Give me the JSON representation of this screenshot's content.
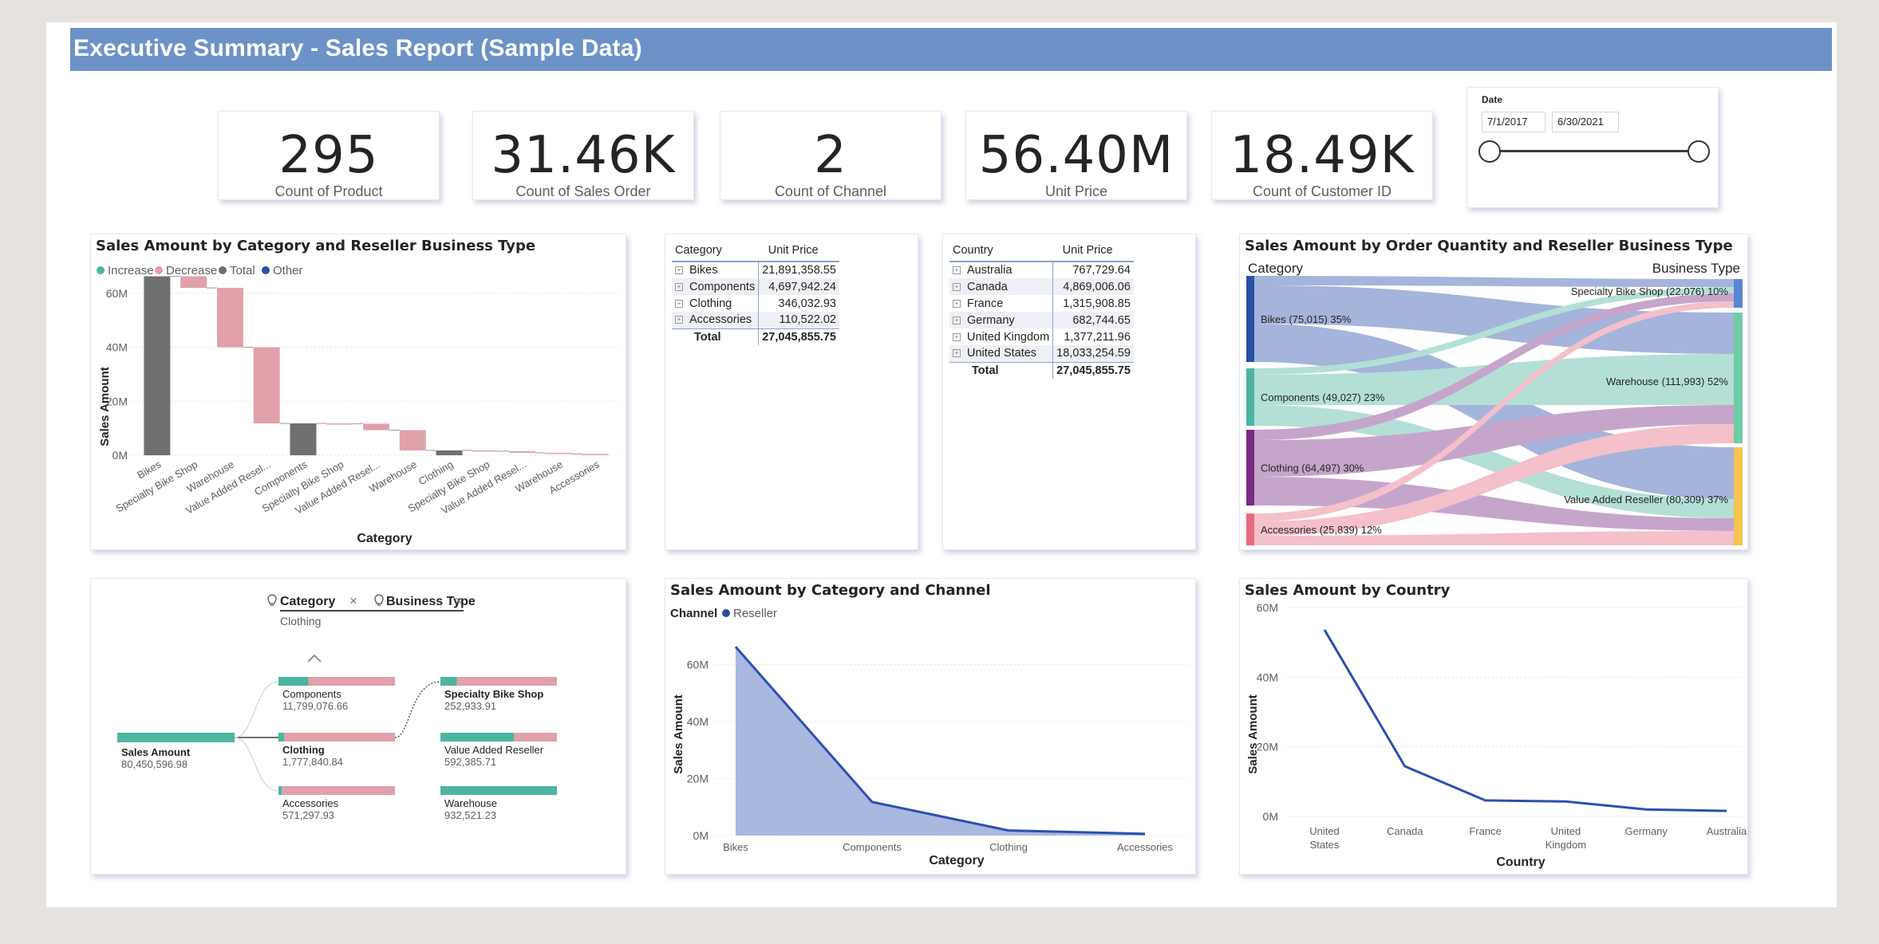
{
  "header": {
    "title": "Executive Summary - Sales Report (Sample Data)"
  },
  "kpis": [
    {
      "value": "295",
      "label": "Count of Product"
    },
    {
      "value": "31.46K",
      "label": "Count of Sales Order"
    },
    {
      "value": "2",
      "label": "Count of Channel"
    },
    {
      "value": "56.40M",
      "label": "Unit Price"
    },
    {
      "value": "18.49K",
      "label": "Count of Customer ID"
    }
  ],
  "date_slicer": {
    "title": "Date",
    "start": "7/1/2017",
    "end": "6/30/2021",
    "range_selected": [
      0,
      1
    ]
  },
  "colors": {
    "increase": "#4cb5a1",
    "decrease": "#e0a1aa",
    "total": "#6f6f6f",
    "other": "#2a4ea8",
    "line": "#2c50b0",
    "area": "#a8b8df"
  },
  "waterfall": {
    "title": "Sales Amount by Category and Reseller Business Type",
    "legend": [
      "Increase",
      "Decrease",
      "Total",
      "Other"
    ],
    "xlabel": "Category",
    "ylabel": "Sales Amount",
    "y_ticks": [
      "60M",
      "40M",
      "20M",
      "0M"
    ]
  },
  "table_category": {
    "headers": [
      "Category",
      "Unit Price"
    ],
    "rows": [
      [
        "Bikes",
        "21,891,358.55"
      ],
      [
        "Components",
        "4,697,942.24"
      ],
      [
        "Clothing",
        "346,032.93"
      ],
      [
        "Accessories",
        "110,522.02"
      ]
    ],
    "total": [
      "Total",
      "27,045,855.75"
    ]
  },
  "table_country": {
    "headers": [
      "Country",
      "Unit Price"
    ],
    "rows": [
      [
        "Australia",
        "767,729.64"
      ],
      [
        "Canada",
        "4,869,006.06"
      ],
      [
        "France",
        "1,315,908.85"
      ],
      [
        "Germany",
        "682,744.65"
      ],
      [
        "United Kingdom",
        "1,377,211.96"
      ],
      [
        "United States",
        "18,033,254.59"
      ]
    ],
    "total": [
      "Total",
      "27,045,855.75"
    ]
  },
  "sankey": {
    "title": "Sales Amount by Order Quantity and Reseller Business Type",
    "left_header": "Category",
    "right_header": "Business Type",
    "left_nodes": [
      "Bikes (75,015) 35%",
      "Components (49,027) 23%",
      "Clothing (64,497) 30%",
      "Accessories (25,839) 12%"
    ],
    "right_nodes": [
      "Specialty Bike Shop (22,076) 10%",
      "Warehouse (111,993) 52%",
      "Value Added Reseller (80,309) 37%"
    ],
    "left_colors": [
      "#2a4ea8",
      "#4cb5a1",
      "#7a2a86",
      "#e66b7f"
    ],
    "right_colors": [
      "#5b86d0",
      "#6fcca6",
      "#f4c24f"
    ]
  },
  "decomp": {
    "level1_title": "Category",
    "level1_sub": "Clothing",
    "level2_title": "Business Type",
    "root": {
      "name": "Sales Amount",
      "value": "80,450,596.98"
    },
    "level1": [
      {
        "name": "Components",
        "value": "11,799,076.66",
        "share": 0.16
      },
      {
        "name": "Clothing",
        "value": "1,777,840.84",
        "share": 0.03
      },
      {
        "name": "Accessories",
        "value": "571,297.93",
        "share": 0.01
      }
    ],
    "level2": [
      {
        "name": "Specialty Bike Shop",
        "value": "252,933.91",
        "share": 0.14
      },
      {
        "name": "Value Added Reseller",
        "value": "592,385.71",
        "share": 0.63
      },
      {
        "name": "Warehouse",
        "value": "932,521.23",
        "share": 1.0
      }
    ]
  },
  "chart_data": [
    {
      "type": "bar",
      "title": "Sales Amount by Category and Reseller Business Type",
      "xlabel": "Category",
      "ylabel": "Sales Amount",
      "ylim": [
        0,
        70
      ],
      "y_unit": "M",
      "legend": [
        "Increase",
        "Decrease",
        "Total",
        "Other"
      ],
      "categories": [
        "Bikes",
        "Specialty Bike Shop",
        "Warehouse",
        "Value Added Resel...",
        "Components",
        "Specialty Bike Shop",
        "Value Added Resel...",
        "Warehouse",
        "Clothing",
        "Specialty Bike Shop",
        "Value Added Resel...",
        "Warehouse",
        "Accessories"
      ],
      "bars": [
        {
          "start": 0,
          "end": 66.3,
          "kind": "total"
        },
        {
          "start": 66.3,
          "end": 62.0,
          "kind": "decrease"
        },
        {
          "start": 62.0,
          "end": 40.0,
          "kind": "decrease"
        },
        {
          "start": 40.0,
          "end": 11.8,
          "kind": "decrease"
        },
        {
          "start": 0,
          "end": 11.8,
          "kind": "total"
        },
        {
          "start": 11.8,
          "end": 11.7,
          "kind": "decrease"
        },
        {
          "start": 11.7,
          "end": 9.3,
          "kind": "decrease"
        },
        {
          "start": 9.3,
          "end": 1.8,
          "kind": "decrease"
        },
        {
          "start": 0,
          "end": 1.8,
          "kind": "total"
        },
        {
          "start": 1.8,
          "end": 1.5,
          "kind": "decrease"
        },
        {
          "start": 1.5,
          "end": 0.9,
          "kind": "decrease"
        },
        {
          "start": 0.9,
          "end": 0.5,
          "kind": "decrease"
        },
        {
          "start": 0.5,
          "end": 0.1,
          "kind": "decrease"
        }
      ]
    },
    {
      "type": "area",
      "title": "Sales Amount by Category and Channel",
      "legend_title": "Channel",
      "series": [
        {
          "name": "Reseller",
          "values": [
            66.3,
            11.8,
            1.8,
            0.6
          ]
        }
      ],
      "categories": [
        "Bikes",
        "Components",
        "Clothing",
        "Accessories"
      ],
      "xlabel": "Category",
      "ylabel": "Sales Amount",
      "ylim": [
        0,
        70
      ],
      "y_ticks": [
        "60M",
        "40M",
        "20M",
        "0M"
      ]
    },
    {
      "type": "line",
      "title": "Sales Amount by Country",
      "categories": [
        "United States",
        "Canada",
        "France",
        "United Kingdom",
        "Germany",
        "Australia"
      ],
      "values": [
        53.6,
        14.4,
        4.6,
        4.3,
        2.0,
        1.6
      ],
      "xlabel": "Country",
      "ylabel": "Sales Amount",
      "ylim": [
        0,
        60
      ],
      "y_ticks": [
        "60M",
        "40M",
        "20M",
        "0M"
      ]
    }
  ]
}
